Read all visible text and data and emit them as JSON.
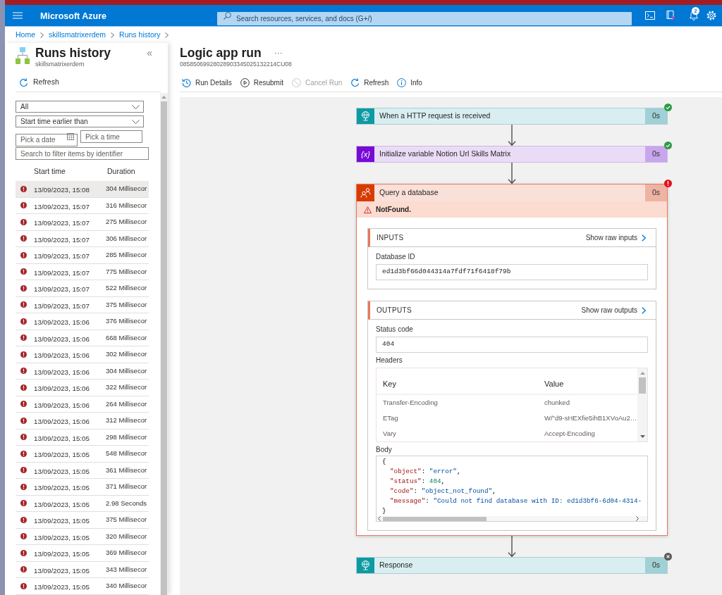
{
  "top_bar": {
    "brand": "Microsoft Azure",
    "search": {
      "placeholder": "Search resources, services, and docs (G+/)"
    },
    "notifications": {
      "count": "2"
    }
  },
  "breadcrumb": [
    "Home",
    "skillsmatrixerdem",
    "Runs history"
  ],
  "runs_panel": {
    "title": "Runs history",
    "subtitle": "skillsmatrixerdem",
    "collapse": "«",
    "toolbar": [
      {
        "kind": "refresh",
        "label": "Refresh"
      }
    ],
    "filters": {
      "status": "All",
      "time_filter": "Start time earlier than",
      "date": {
        "placeholder": "Pick a date"
      },
      "time": {
        "placeholder": "Pick a time"
      },
      "search": {
        "placeholder": "Search to filter items by identifier"
      }
    },
    "table": {
      "columns": [
        "Start time",
        "Duration"
      ],
      "rows": [
        {
          "failed": true,
          "start_time": "13/09/2023, 15:08",
          "duration": "304 Millisecor",
          "selected": true
        },
        {
          "failed": true,
          "start_time": "13/09/2023, 15:07",
          "duration": "316 Millisecor",
          "selected": false
        },
        {
          "failed": true,
          "start_time": "13/09/2023, 15:07",
          "duration": "275 Millisecor",
          "selected": false
        },
        {
          "failed": true,
          "start_time": "13/09/2023, 15:07",
          "duration": "306 Millisecor",
          "selected": false
        },
        {
          "failed": true,
          "start_time": "13/09/2023, 15:07",
          "duration": "285 Millisecor",
          "selected": false
        },
        {
          "failed": true,
          "start_time": "13/09/2023, 15:07",
          "duration": "775 Millisecor",
          "selected": false
        },
        {
          "failed": true,
          "start_time": "13/09/2023, 15:07",
          "duration": "522 Millisecor",
          "selected": false
        },
        {
          "failed": true,
          "start_time": "13/09/2023, 15:07",
          "duration": "375 Millisecor",
          "selected": false
        },
        {
          "failed": true,
          "start_time": "13/09/2023, 15:06",
          "duration": "376 Millisecor",
          "selected": false
        },
        {
          "failed": true,
          "start_time": "13/09/2023, 15:06",
          "duration": "668 Millisecor",
          "selected": false
        },
        {
          "failed": true,
          "start_time": "13/09/2023, 15:06",
          "duration": "302 Millisecor",
          "selected": false
        },
        {
          "failed": true,
          "start_time": "13/09/2023, 15:06",
          "duration": "304 Millisecor",
          "selected": false
        },
        {
          "failed": true,
          "start_time": "13/09/2023, 15:06",
          "duration": "322 Millisecor",
          "selected": false
        },
        {
          "failed": true,
          "start_time": "13/09/2023, 15:06",
          "duration": "264 Millisecor",
          "selected": false
        },
        {
          "failed": true,
          "start_time": "13/09/2023, 15:06",
          "duration": "312 Millisecor",
          "selected": false
        },
        {
          "failed": true,
          "start_time": "13/09/2023, 15:05",
          "duration": "298 Millisecor",
          "selected": false
        },
        {
          "failed": true,
          "start_time": "13/09/2023, 15:05",
          "duration": "548 Millisecor",
          "selected": false
        },
        {
          "failed": true,
          "start_time": "13/09/2023, 15:05",
          "duration": "361 Millisecor",
          "selected": false
        },
        {
          "failed": true,
          "start_time": "13/09/2023, 15:05",
          "duration": "371 Millisecor",
          "selected": false
        },
        {
          "failed": true,
          "start_time": "13/09/2023, 15:05",
          "duration": "2.98 Seconds",
          "selected": false
        },
        {
          "failed": true,
          "start_time": "13/09/2023, 15:05",
          "duration": "375 Millisecor",
          "selected": false
        },
        {
          "failed": true,
          "start_time": "13/09/2023, 15:05",
          "duration": "320 Millisecor",
          "selected": false
        },
        {
          "failed": true,
          "start_time": "13/09/2023, 15:05",
          "duration": "369 Millisecor",
          "selected": false
        },
        {
          "failed": true,
          "start_time": "13/09/2023, 15:05",
          "duration": "343 Millisecor",
          "selected": false
        },
        {
          "failed": true,
          "start_time": "13/09/2023, 15:05",
          "duration": "340 Millisecor",
          "selected": false
        }
      ]
    }
  },
  "run": {
    "title": "Logic app run",
    "more": "···",
    "id": "08585069928028903345025132214CU08",
    "toolbar": [
      {
        "kind": "history",
        "label": "Run Details",
        "disabled": false
      },
      {
        "kind": "resubmit",
        "label": "Resubmit",
        "disabled": false
      },
      {
        "kind": "cancel",
        "label": "Cancel Run",
        "disabled": true
      },
      {
        "kind": "refresh",
        "label": "Refresh",
        "disabled": false
      },
      {
        "kind": "info",
        "label": "Info",
        "disabled": false
      }
    ],
    "actions": [
      {
        "kind": "request",
        "title": "When a HTTP request is received",
        "duration": "0s",
        "badge": {
          "kind": "succeeded"
        },
        "expanded": false
      },
      {
        "kind": "variable",
        "icon_text": "{x}",
        "title": "Initialize variable Notion Url Skills Matrix",
        "duration": "0s",
        "badge": {
          "kind": "succeeded"
        },
        "expanded": false
      },
      {
        "kind": "connector",
        "title": "Query a database",
        "duration": "0s",
        "badge": {
          "kind": "failed"
        },
        "expanded": true,
        "error": "NotFound.",
        "sections": [
          {
            "heading": "INPUTS",
            "raw_link": "Show raw inputs",
            "fields": [
              {
                "kind": "text",
                "label": "Database ID",
                "value": "ed1d3bf66d044314a7fdf71f6418f79b"
              }
            ]
          },
          {
            "heading": "OUTPUTS",
            "raw_link": "Show raw outputs",
            "fields": [
              {
                "kind": "text",
                "label": "Status code",
                "value": "404"
              },
              {
                "kind": "table",
                "label": "Headers",
                "columns": [
                  "Key",
                  "Value"
                ],
                "rows": [
                  {
                    "key": "Transfer-Encoding",
                    "value": "chunked"
                  },
                  {
                    "key": "ETag",
                    "value": "W/\"d9-sHEXfie5ihB1XVoAu2…"
                  },
                  {
                    "key": "Vary",
                    "value": "Accept-Encoding"
                  }
                ]
              },
              {
                "kind": "code",
                "label": "Body",
                "open": "{",
                "members": [
                  {
                    "key": "\"object\"",
                    "colon": ":",
                    "value": "\"error\"",
                    "kind": "string",
                    "comma": ","
                  },
                  {
                    "key": "\"status\"",
                    "colon": ":",
                    "value": "404",
                    "kind": "number",
                    "comma": ","
                  },
                  {
                    "key": "\"code\"",
                    "colon": ":",
                    "value": "\"object_not_found\"",
                    "kind": "string",
                    "comma": ","
                  },
                  {
                    "key": "\"message\"",
                    "colon": ":",
                    "value": "\"Could not find database with ID: ed1d3bf6-6d04-4314-",
                    "kind": "string"
                  }
                ],
                "close": "}"
              }
            ]
          }
        ]
      },
      {
        "kind": "response",
        "title": "Response",
        "duration": "0s",
        "badge": {
          "kind": "skipped"
        },
        "expanded": false
      }
    ]
  }
}
